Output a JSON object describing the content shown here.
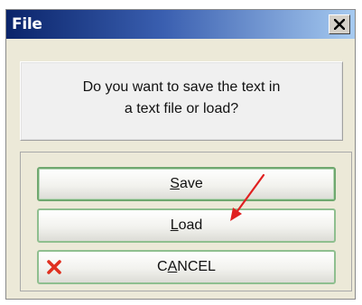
{
  "window": {
    "title": "File"
  },
  "message": {
    "line1": "Do you want to save the text in",
    "line2": "a text file or load?"
  },
  "buttons": {
    "save": {
      "mnemonic": "S",
      "rest": "ave"
    },
    "load": {
      "mnemonic": "L",
      "rest": "oad"
    },
    "cancel": {
      "pre": "C",
      "mnemonic": "A",
      "rest": "NCEL"
    }
  },
  "icons": {
    "close": "close-x-icon",
    "cancel": "red-x-icon",
    "annotation": "red-arrow-icon"
  },
  "colors": {
    "titlebar_start": "#0a246a",
    "titlebar_end": "#a6caf0",
    "button_border": "#8fbf8f",
    "cancel_icon": "#e03020",
    "annotation_arrow": "#e02020"
  }
}
